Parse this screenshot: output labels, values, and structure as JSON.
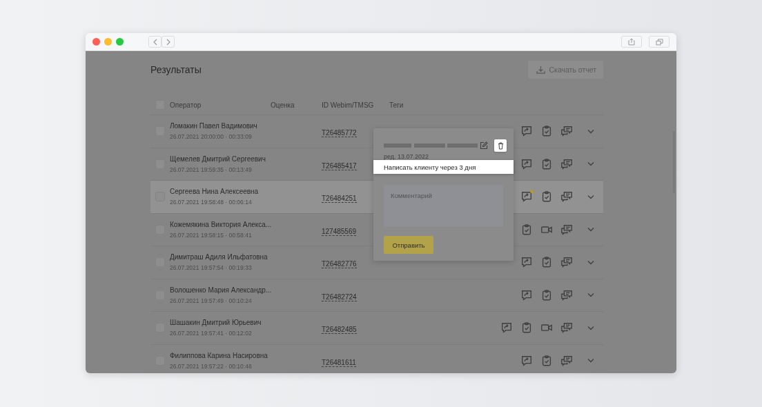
{
  "page": {
    "title": "Результаты",
    "download_button": "Скачать отчет"
  },
  "table": {
    "header_checkbox": {
      "checked": false
    },
    "columns": [
      "Оператор",
      "Оценка",
      "ID Webim/TMSG",
      "Теги"
    ],
    "rows": [
      {
        "name": "Ломакин Павел Вадимович",
        "meta": "26.07.2021 20:00:00 · 00:33:09",
        "id": "T26485772",
        "checked": false,
        "selected": false,
        "icons": [
          {
            "kind": "reply",
            "badge": false
          },
          {
            "kind": "clipboard",
            "badge": false
          },
          {
            "kind": "chats",
            "badge": false
          }
        ]
      },
      {
        "name": "Щемелев Дмитрий Сергеевич",
        "meta": "26.07.2021 19:59:35 · 00:13:49",
        "id": "T26485417",
        "checked": false,
        "selected": false,
        "icons": [
          {
            "kind": "reply",
            "badge": false
          },
          {
            "kind": "clipboard",
            "badge": false
          },
          {
            "kind": "chats",
            "badge": false
          }
        ]
      },
      {
        "name": "Сергеева Нина Алексеевна",
        "meta": "26.07.2021 19:58:48 · 00:06:14",
        "id": "T26484251",
        "checked": false,
        "selected": true,
        "icons": [
          {
            "kind": "reply",
            "badge": true
          },
          {
            "kind": "clipboard",
            "badge": false
          },
          {
            "kind": "chats",
            "badge": false
          }
        ]
      },
      {
        "name": "Кожемякина Виктория Алекса...",
        "meta": "26.07.2021 19:58:15 · 00:58:41",
        "id": "127485569",
        "checked": false,
        "selected": false,
        "icons": [
          {
            "kind": "clipboard",
            "badge": false
          },
          {
            "kind": "video",
            "badge": false
          },
          {
            "kind": "chats",
            "badge": false
          }
        ]
      },
      {
        "name": "Димитраш Адиля Ильфатовна",
        "meta": "26.07.2021 19:57:54 · 00:19:33",
        "id": "T26482776",
        "checked": false,
        "selected": false,
        "icons": [
          {
            "kind": "reply",
            "badge": false
          },
          {
            "kind": "clipboard",
            "badge": false
          },
          {
            "kind": "chats",
            "badge": false
          }
        ]
      },
      {
        "name": "Волошенко Мария Александр...",
        "meta": "26.07.2021 19:57:49 · 00:10:24",
        "id": "T26482724",
        "checked": false,
        "selected": false,
        "icons": [
          {
            "kind": "reply",
            "badge": false
          },
          {
            "kind": "clipboard",
            "badge": false
          },
          {
            "kind": "chats",
            "badge": false
          }
        ]
      },
      {
        "name": "Шашакин Дмитрий Юрьевич",
        "meta": "26.07.2021 19:57:41 · 00:12:02",
        "id": "T26482485",
        "checked": false,
        "selected": false,
        "icons": [
          {
            "kind": "reply",
            "badge": false
          },
          {
            "kind": "clipboard",
            "badge": false
          },
          {
            "kind": "video",
            "badge": false
          },
          {
            "kind": "chats",
            "badge": false
          }
        ]
      },
      {
        "name": "Филиппова Карина Насировна",
        "meta": "26.07.2021 19:57:22 · 00:10:48",
        "id": "T26481611",
        "checked": false,
        "selected": false,
        "icons": [
          {
            "kind": "reply",
            "badge": false
          },
          {
            "kind": "clipboard",
            "badge": false
          },
          {
            "kind": "chats",
            "badge": false
          }
        ]
      }
    ]
  },
  "popup": {
    "edited": "ред. 13.07.2022",
    "note": "Написать клиенту через 3 дня",
    "comment": {
      "placeholder": "Комментарий"
    },
    "send_button": "Отправить"
  }
}
